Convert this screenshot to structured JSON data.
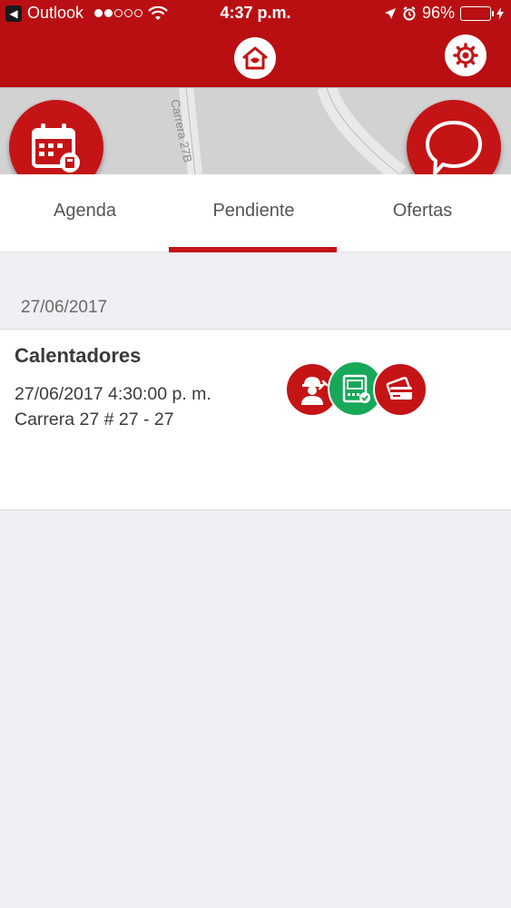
{
  "status_bar": {
    "back_app": "Outlook",
    "time": "4:37 p.m.",
    "battery": "96%"
  },
  "nav": {
    "home_icon": "home-icon",
    "settings_icon": "gear-icon"
  },
  "map": {
    "street_label": "Carrera 27B"
  },
  "fabs": {
    "left_icon": "calendar-icon",
    "right_icon": "chat-bubble-icon"
  },
  "tabs": [
    {
      "label": "Agenda"
    },
    {
      "label": "Pendiente"
    },
    {
      "label": "Ofertas"
    }
  ],
  "active_tab": "Pendiente",
  "section": {
    "date": "27/06/2017",
    "items": [
      {
        "title": "Calentadores",
        "datetime": "27/06/2017 4:30:00 p. m.",
        "address": "Carrera 27 # 27 - 27",
        "badges": [
          "technician-icon",
          "checklist-icon",
          "payment-card-icon"
        ]
      }
    ]
  },
  "colors": {
    "brand_red": "#b90f12",
    "accent_red": "#c41416",
    "green": "#17a85a",
    "battery_green": "#4cd964",
    "background": "#efeff4"
  }
}
